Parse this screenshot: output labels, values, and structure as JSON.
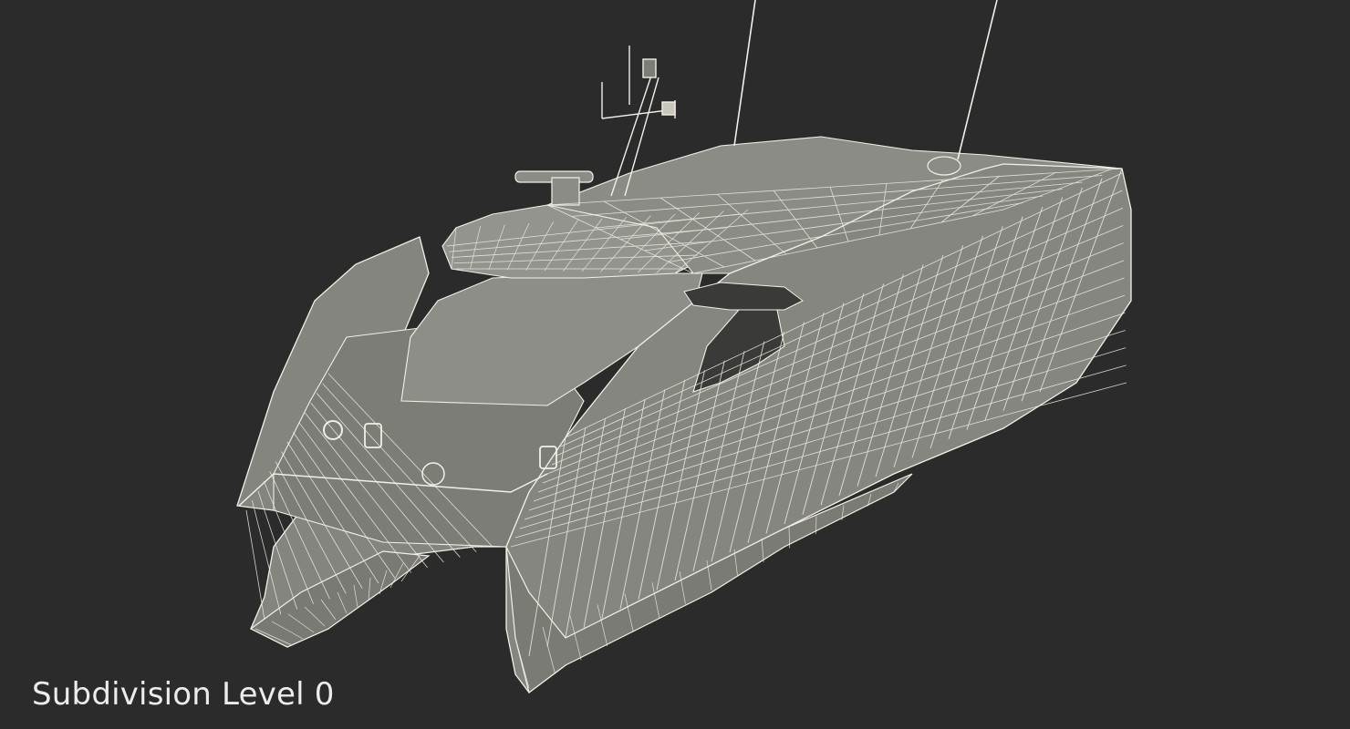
{
  "viewport": {
    "background": "#2b2b2b",
    "model": "catamaran-wireframe"
  },
  "caption": {
    "text": "Subdivision Level 0"
  },
  "colors": {
    "hull_fill": "#8a8a84",
    "hull_fill_dark": "#6f6f6a",
    "wire": "#f2f0e6",
    "background": "#2b2b2b"
  }
}
